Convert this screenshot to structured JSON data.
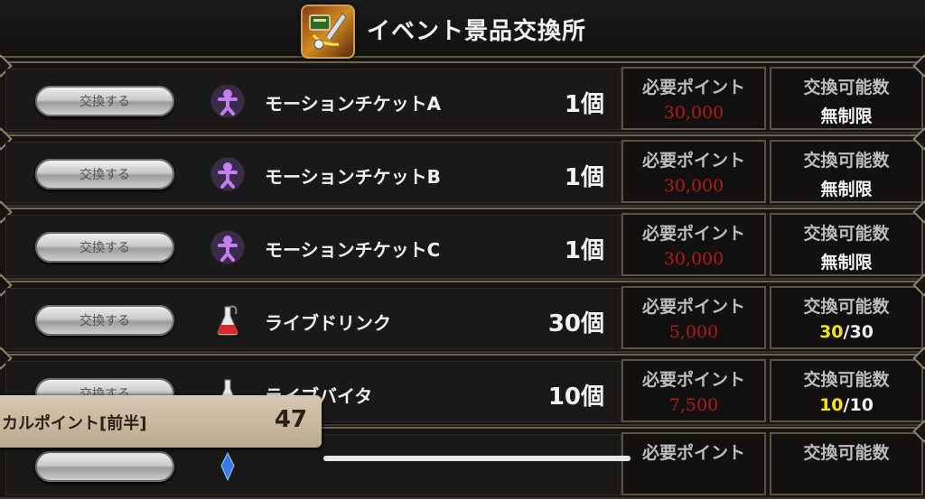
{
  "header": {
    "title": "イベント景品交換所",
    "icon": "event-exchange-icon"
  },
  "labels": {
    "points": "必要ポイント",
    "limit": "交換可能数"
  },
  "rows": [
    {
      "button": "交換する",
      "icon": "motion-ticket-icon",
      "name": "モーションチケットA",
      "qty": "1個",
      "points": "30,000",
      "limit": "無制限",
      "limit_current": "",
      "limit_total": ""
    },
    {
      "button": "交換する",
      "icon": "motion-ticket-icon",
      "name": "モーションチケットB",
      "qty": "1個",
      "points": "30,000",
      "limit": "無制限",
      "limit_current": "",
      "limit_total": ""
    },
    {
      "button": "交換する",
      "icon": "motion-ticket-icon",
      "name": "モーションチケットC",
      "qty": "1個",
      "points": "30,000",
      "limit": "無制限",
      "limit_current": "",
      "limit_total": ""
    },
    {
      "button": "交換する",
      "icon": "potion-icon",
      "name": "ライブドリンク",
      "qty": "30個",
      "points": "5,000",
      "limit": "",
      "limit_current": "30",
      "limit_total": "/30"
    },
    {
      "button": "交換する",
      "icon": "potion-icon",
      "name": "ライブバイタ",
      "qty": "10個",
      "points": "7,500",
      "limit": "",
      "limit_current": "10",
      "limit_total": "/10"
    },
    {
      "button": "",
      "icon": "crystal-icon",
      "name": "",
      "qty": "",
      "points": "",
      "limit": "",
      "limit_current": "",
      "limit_total": ""
    }
  ],
  "overlay": {
    "label": "カルポイント[前半]",
    "value": "47"
  },
  "colors": {
    "points": "#b11a1a",
    "limit_current": "#f5e316",
    "frame": "#6f6452"
  }
}
